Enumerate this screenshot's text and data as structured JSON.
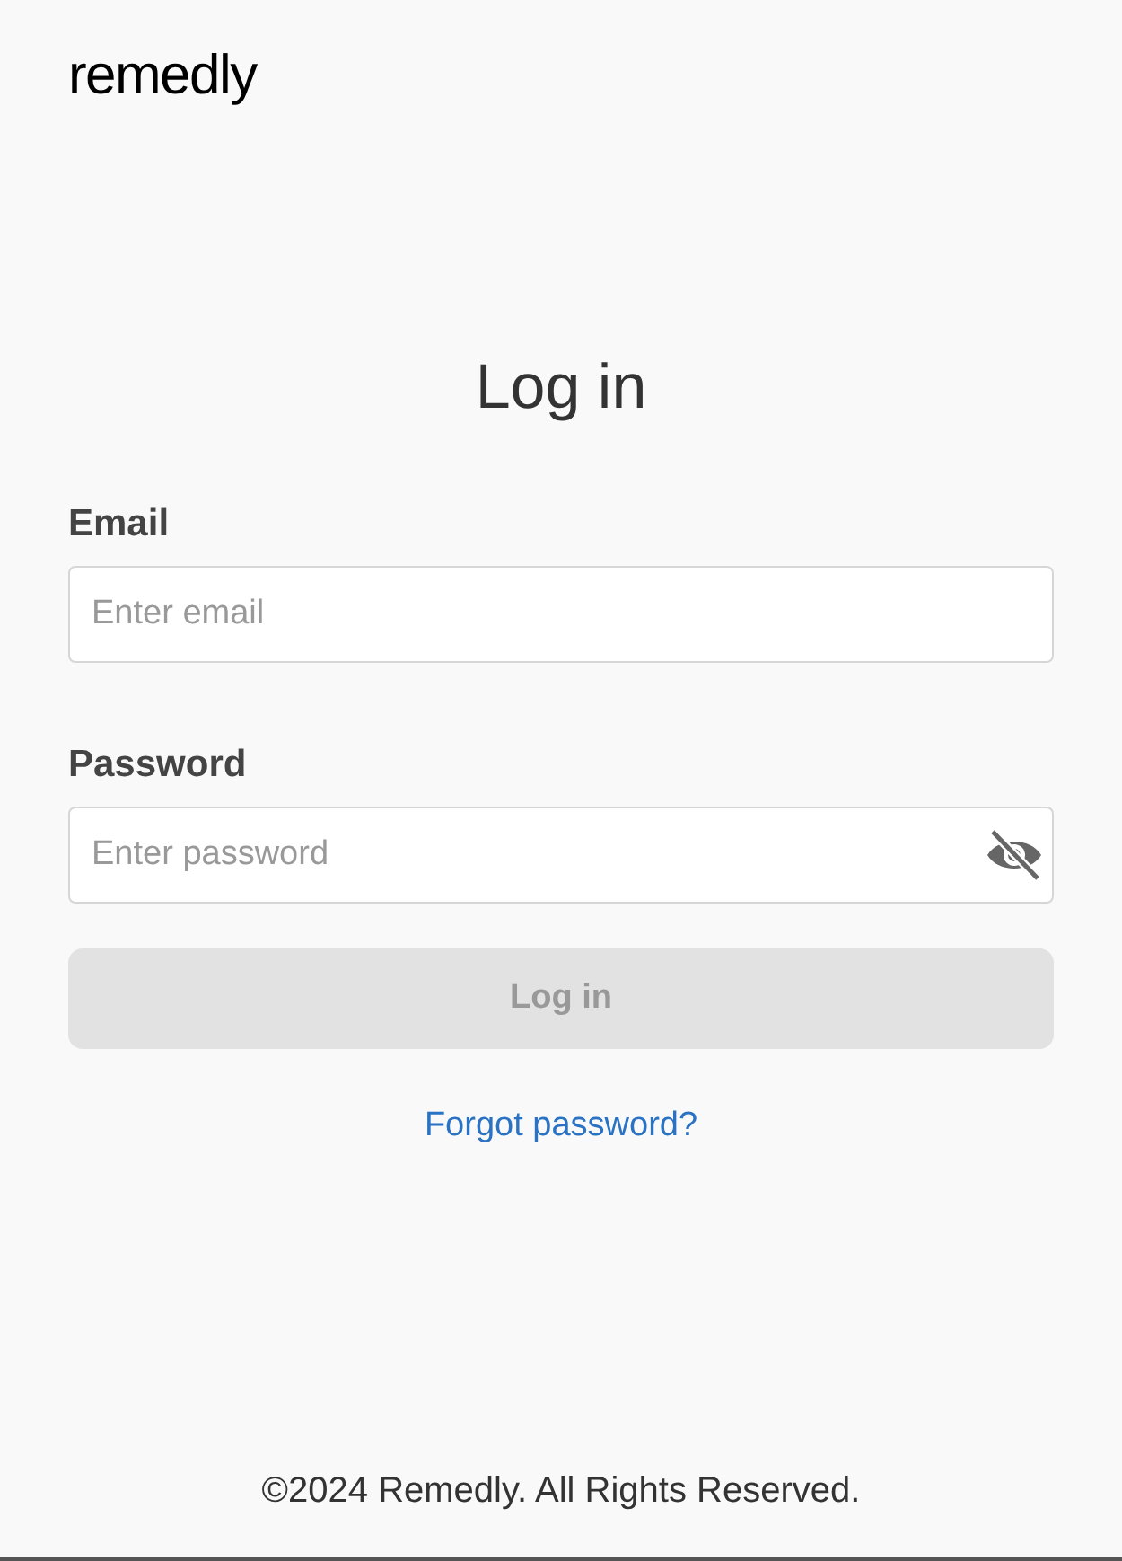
{
  "logo": "remedly",
  "title": "Log in",
  "fields": [
    {
      "label": "Email",
      "placeholder": "Enter email",
      "kind": "text"
    },
    {
      "label": "Password",
      "placeholder": "Enter password",
      "kind": "password",
      "password_visible": false
    }
  ],
  "submit": {
    "label": "Log in",
    "disabled": true
  },
  "forgot_link": "Forgot password?",
  "footer": "©2024 Remedly. All Rights Reserved."
}
